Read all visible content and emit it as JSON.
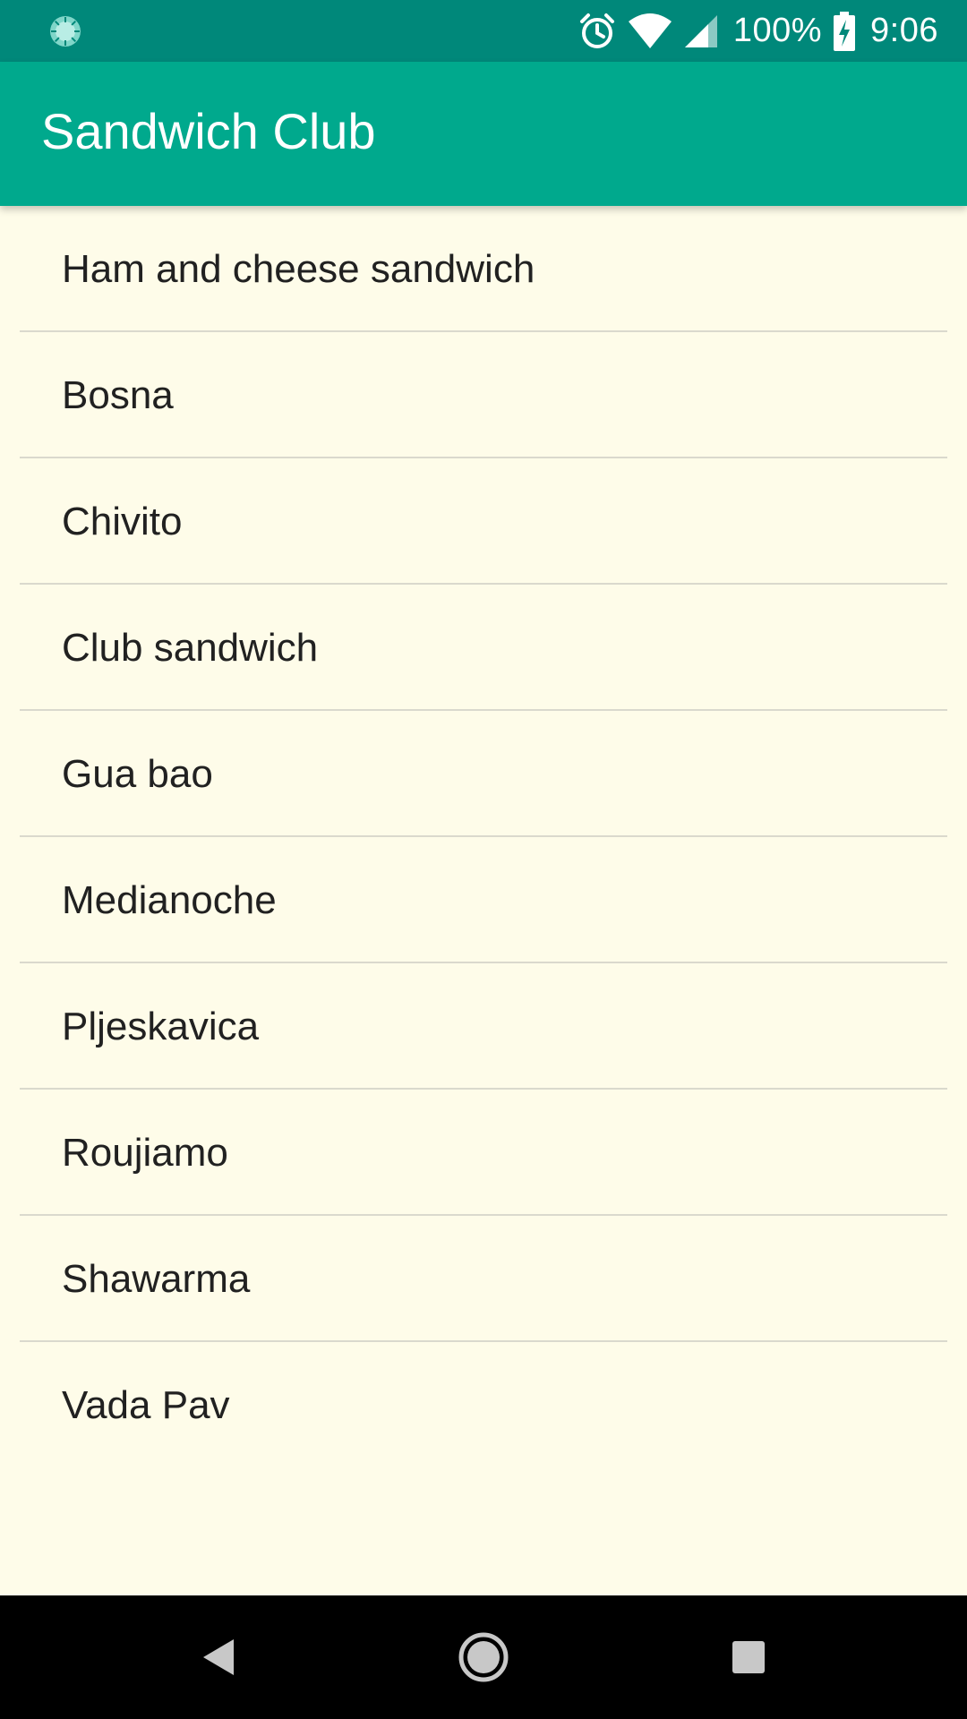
{
  "status_bar": {
    "battery": "100%",
    "time": "9:06",
    "icons": [
      "sync-icon",
      "alarm-icon",
      "wifi-icon",
      "cellular-icon",
      "battery-charging-icon"
    ]
  },
  "app_bar": {
    "title": "Sandwich Club"
  },
  "sandwiches": [
    "Ham and cheese sandwich",
    "Bosna",
    "Chivito",
    "Club sandwich",
    "Gua bao",
    "Medianoche",
    "Pljeskavica",
    "Roujiamo",
    "Shawarma",
    "Vada Pav"
  ],
  "nav_bar": {
    "icons": [
      "back-icon",
      "home-icon",
      "recents-icon"
    ]
  },
  "colors": {
    "status_bar": "#00887A",
    "app_bar": "#00A98D",
    "background": "#FEFCE9",
    "text": "#212121",
    "divider": "#DAD9CD",
    "nav_bar": "#000000"
  }
}
